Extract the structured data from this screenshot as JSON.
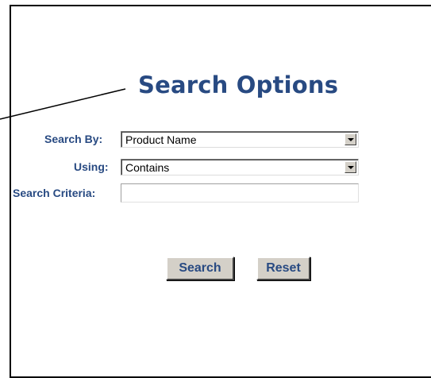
{
  "title": "Search Options",
  "form": {
    "search_by": {
      "label": "Search By:",
      "value": "Product Name"
    },
    "using": {
      "label": "Using:",
      "value": "Contains"
    },
    "criteria": {
      "label": "Search Criteria:",
      "value": ""
    }
  },
  "buttons": {
    "search": "Search",
    "reset": "Reset"
  },
  "colors": {
    "label": "#284a82",
    "button_face": "#d4d0c8"
  }
}
